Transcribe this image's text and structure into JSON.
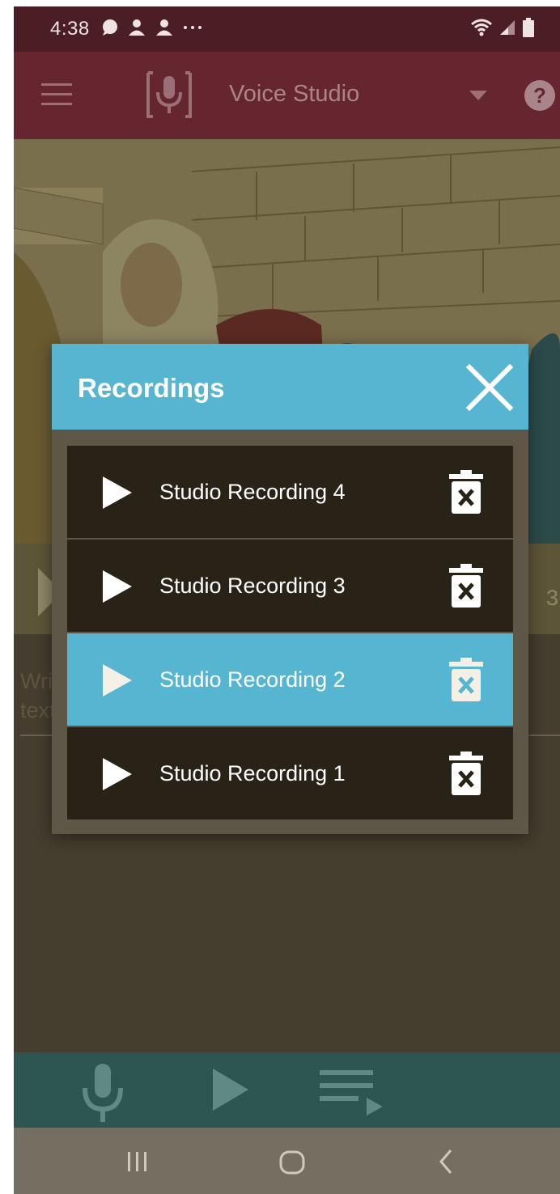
{
  "status_bar": {
    "time": "4:38",
    "icons_left": [
      "chat-bubble-icon",
      "person-icon",
      "person-icon",
      "more-dots-icon"
    ],
    "icons_right": [
      "wifi-icon",
      "signal-icon",
      "battery-icon"
    ]
  },
  "app_bar": {
    "title": "Voice Studio",
    "icons": [
      "menu-icon",
      "microphone-logo-icon",
      "dropdown-icon",
      "help-icon"
    ]
  },
  "scene": {
    "slide_count": "3",
    "text_hint": "Write text"
  },
  "dialog": {
    "title": "Recordings",
    "recordings": [
      {
        "label": "Studio Recording 4",
        "selected": false
      },
      {
        "label": "Studio Recording 3",
        "selected": false
      },
      {
        "label": "Studio Recording 2",
        "selected": true
      },
      {
        "label": "Studio Recording 1",
        "selected": false
      }
    ]
  },
  "toolbar": {
    "icons": [
      "microphone-icon",
      "play-icon",
      "playlist-play-icon"
    ]
  },
  "nav": {
    "icons": [
      "recents-icon",
      "home-icon",
      "back-icon"
    ]
  },
  "colors": {
    "app_bar": "#66262f",
    "status_bar": "#4b1e25",
    "dialog_header": "#56b6d2",
    "row_bg": "#292217",
    "row_selected": "#56b6d2",
    "toolbar": "#2d5551"
  }
}
